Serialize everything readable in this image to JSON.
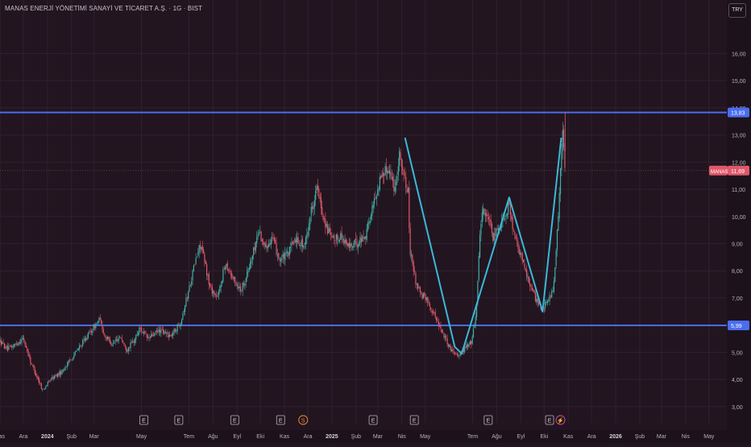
{
  "header": {
    "title": "MANAS ENERJİ YÖNETİMİ SANAYİ VE TİCARET A.Ş. · 1G · BIST",
    "currency": "TRY"
  },
  "colors": {
    "background": "#221520",
    "grid": "#2f2230",
    "axis_text": "#b8b0b6",
    "up": "#3fb0a6",
    "down": "#e0586a",
    "hline": "#4a6cf0",
    "pattern": "#3cb8d8",
    "last_price": "#e0586a"
  },
  "chart_data": {
    "type": "candlestick",
    "ylim": [
      2.4,
      17.2
    ],
    "y_ticks": [
      "3,00",
      "4,00",
      "5,00",
      "6,00",
      "7,00",
      "8,00",
      "9,00",
      "10,00",
      "11,00",
      "12,00",
      "13,00",
      "14,00",
      "15,00",
      "16,00"
    ],
    "x_ticks": [
      "Kas",
      "Ara",
      "2024",
      "Şub",
      "Mar",
      "May",
      "Tem",
      "Ağu",
      "Eyl",
      "Eki",
      "Kas",
      "Ara",
      "2025",
      "Şub",
      "Mar",
      "Nis",
      "May",
      "Tem",
      "Ağu",
      "Eyl",
      "Eki",
      "Kas",
      "Ara",
      "2026",
      "Şub",
      "Mar",
      "Nis",
      "May"
    ],
    "x_tick_days": [
      0,
      30,
      61,
      92,
      121,
      182,
      243,
      274,
      305,
      335,
      366,
      396,
      427,
      458,
      486,
      517,
      547,
      608,
      639,
      670,
      700,
      731,
      761,
      792,
      823,
      851,
      882,
      912
    ],
    "x_domain_days": [
      0,
      935
    ],
    "horizontal_lines": [
      {
        "value": 13.83,
        "label": "13,83"
      },
      {
        "value": 5.99,
        "label": "5,99"
      }
    ],
    "last_price": {
      "symbol": "MANAS",
      "value": 11.69,
      "label": "11,69"
    },
    "price_path": [
      [
        0,
        5.4
      ],
      [
        10,
        5.1
      ],
      [
        20,
        5.3
      ],
      [
        30,
        5.5
      ],
      [
        40,
        4.6
      ],
      [
        55,
        3.6
      ],
      [
        65,
        4.0
      ],
      [
        80,
        4.3
      ],
      [
        95,
        4.9
      ],
      [
        110,
        5.5
      ],
      [
        120,
        5.9
      ],
      [
        128,
        6.2
      ],
      [
        135,
        5.6
      ],
      [
        145,
        5.3
      ],
      [
        155,
        5.6
      ],
      [
        162,
        5.1
      ],
      [
        172,
        5.4
      ],
      [
        180,
        5.9
      ],
      [
        190,
        5.5
      ],
      [
        205,
        5.8
      ],
      [
        220,
        5.6
      ],
      [
        232,
        6.1
      ],
      [
        242,
        7.2
      ],
      [
        250,
        8.2
      ],
      [
        258,
        9.0
      ],
      [
        265,
        8.1
      ],
      [
        270,
        7.4
      ],
      [
        280,
        7.0
      ],
      [
        290,
        8.3
      ],
      [
        300,
        7.7
      ],
      [
        310,
        7.3
      ],
      [
        318,
        7.9
      ],
      [
        326,
        8.7
      ],
      [
        333,
        9.5
      ],
      [
        340,
        8.9
      ],
      [
        350,
        9.2
      ],
      [
        360,
        8.4
      ],
      [
        370,
        8.6
      ],
      [
        380,
        9.2
      ],
      [
        392,
        8.9
      ],
      [
        400,
        10.2
      ],
      [
        408,
        11.1
      ],
      [
        413,
        10.3
      ],
      [
        420,
        9.6
      ],
      [
        428,
        9.1
      ],
      [
        438,
        9.3
      ],
      [
        448,
        8.9
      ],
      [
        458,
        9.0
      ],
      [
        470,
        9.3
      ],
      [
        480,
        10.4
      ],
      [
        490,
        11.5
      ],
      [
        500,
        11.8
      ],
      [
        508,
        11.0
      ],
      [
        514,
        12.4
      ],
      [
        520,
        11.4
      ],
      [
        525,
        10.9
      ],
      [
        527,
        8.8
      ],
      [
        535,
        7.6
      ],
      [
        542,
        7.1
      ],
      [
        550,
        6.9
      ],
      [
        560,
        6.3
      ],
      [
        570,
        5.7
      ],
      [
        580,
        5.1
      ],
      [
        590,
        4.9
      ],
      [
        600,
        5.2
      ],
      [
        607,
        5.4
      ],
      [
        613,
        6.6
      ],
      [
        617,
        9.3
      ],
      [
        621,
        10.3
      ],
      [
        628,
        9.9
      ],
      [
        634,
        9.2
      ],
      [
        642,
        9.6
      ],
      [
        650,
        10.1
      ],
      [
        655,
        10.5
      ],
      [
        660,
        9.4
      ],
      [
        667,
        8.8
      ],
      [
        675,
        8.1
      ],
      [
        683,
        7.4
      ],
      [
        690,
        6.9
      ],
      [
        698,
        6.6
      ],
      [
        705,
        6.9
      ],
      [
        710,
        7.2
      ],
      [
        713,
        7.6
      ],
      [
        716,
        8.9
      ],
      [
        719,
        10.6
      ],
      [
        722,
        12.1
      ],
      [
        724,
        13.1
      ],
      [
        726,
        12.3
      ],
      [
        727,
        11.69
      ]
    ],
    "pattern_points": [
      [
        521,
        12.9
      ],
      [
        585,
        5.2
      ],
      [
        594,
        4.95
      ],
      [
        655,
        10.7
      ],
      [
        698,
        6.5
      ],
      [
        722,
        12.9
      ]
    ],
    "events": [
      {
        "day": 185,
        "label": "E",
        "kind": "earnings"
      },
      {
        "day": 230,
        "label": "E",
        "kind": "earnings"
      },
      {
        "day": 302,
        "label": "E",
        "kind": "earnings"
      },
      {
        "day": 361,
        "label": "E",
        "kind": "earnings"
      },
      {
        "day": 390,
        "label": "S",
        "kind": "split"
      },
      {
        "day": 480,
        "label": "E",
        "kind": "earnings"
      },
      {
        "day": 533,
        "label": "E",
        "kind": "earnings"
      },
      {
        "day": 628,
        "label": "E",
        "kind": "earnings"
      },
      {
        "day": 707,
        "label": "E",
        "kind": "earnings"
      },
      {
        "day": 721,
        "label": "⚡",
        "kind": "alert"
      }
    ]
  }
}
